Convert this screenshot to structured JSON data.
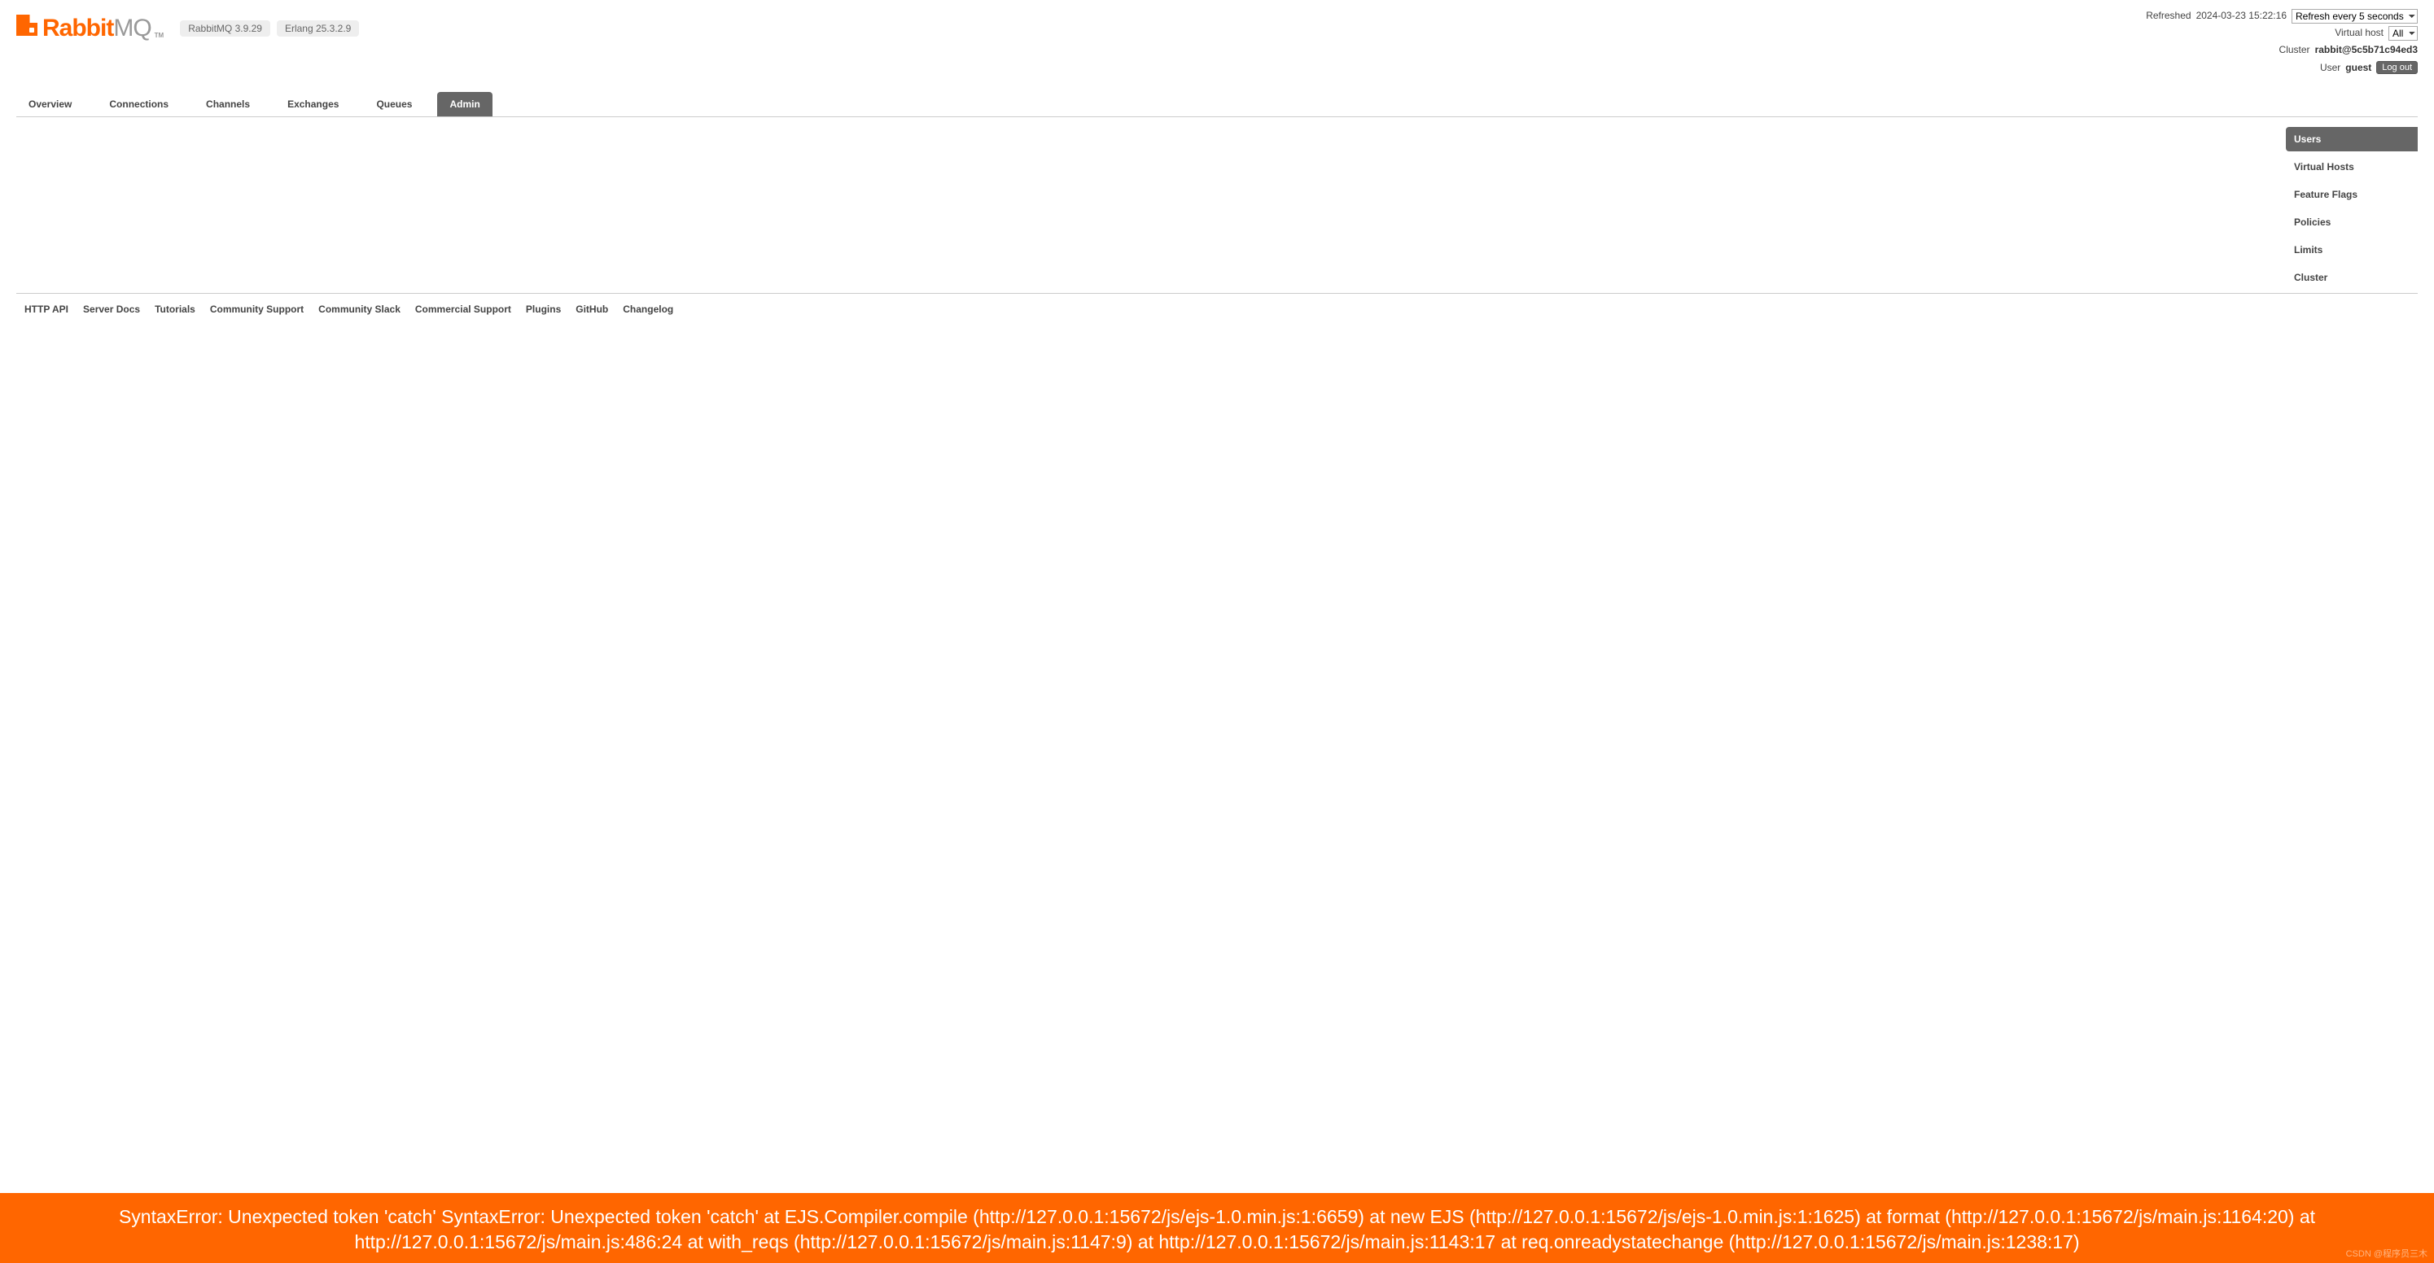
{
  "logo": {
    "brand1": "Rabbit",
    "brand2": "MQ",
    "tm": "TM"
  },
  "versions": {
    "rabbitmq": "RabbitMQ 3.9.29",
    "erlang": "Erlang 25.3.2.9"
  },
  "status": {
    "refreshed_label": "Refreshed",
    "refreshed_time": "2024-03-23 15:22:16",
    "refresh_interval": "Refresh every 5 seconds",
    "vhost_label": "Virtual host",
    "vhost_value": "All",
    "cluster_label": "Cluster",
    "cluster_name": "rabbit@5c5b71c94ed3",
    "user_label": "User",
    "user_name": "guest",
    "logout": "Log out"
  },
  "tabs": [
    {
      "label": "Overview",
      "active": false
    },
    {
      "label": "Connections",
      "active": false
    },
    {
      "label": "Channels",
      "active": false
    },
    {
      "label": "Exchanges",
      "active": false
    },
    {
      "label": "Queues",
      "active": false
    },
    {
      "label": "Admin",
      "active": true
    }
  ],
  "side_nav": [
    {
      "label": "Users",
      "active": true
    },
    {
      "label": "Virtual Hosts",
      "active": false
    },
    {
      "label": "Feature Flags",
      "active": false
    },
    {
      "label": "Policies",
      "active": false
    },
    {
      "label": "Limits",
      "active": false
    },
    {
      "label": "Cluster",
      "active": false
    }
  ],
  "footer_links": [
    "HTTP API",
    "Server Docs",
    "Tutorials",
    "Community Support",
    "Community Slack",
    "Commercial Support",
    "Plugins",
    "GitHub",
    "Changelog"
  ],
  "error_message": "SyntaxError: Unexpected token 'catch' SyntaxError: Unexpected token 'catch' at EJS.Compiler.compile (http://127.0.0.1:15672/js/ejs-1.0.min.js:1:6659) at new EJS (http://127.0.0.1:15672/js/ejs-1.0.min.js:1:1625) at format (http://127.0.0.1:15672/js/main.js:1164:20) at http://127.0.0.1:15672/js/main.js:486:24 at with_reqs (http://127.0.0.1:15672/js/main.js:1147:9) at http://127.0.0.1:15672/js/main.js:1143:17 at req.onreadystatechange (http://127.0.0.1:15672/js/main.js:1238:17)",
  "watermark": "CSDN @程序员三木"
}
